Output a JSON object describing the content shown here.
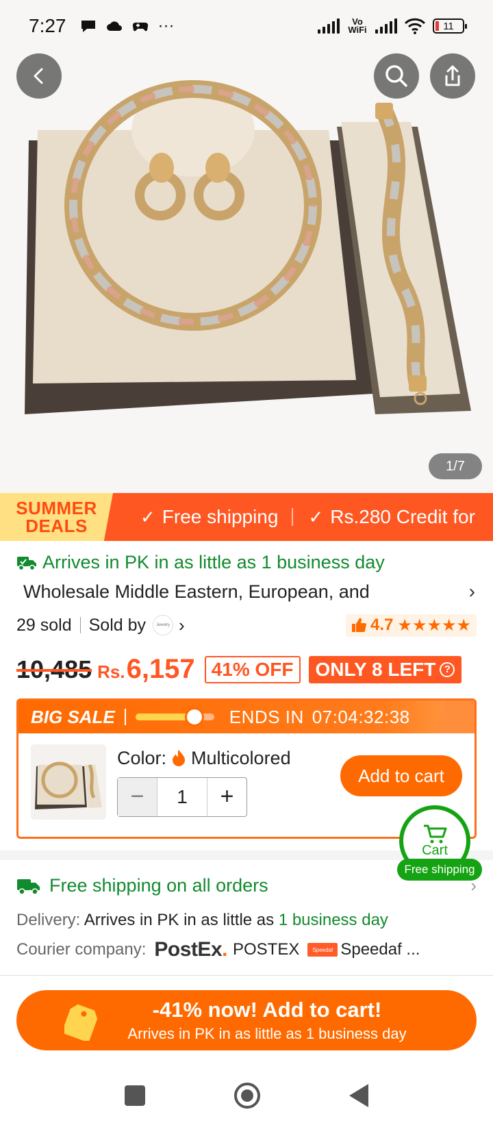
{
  "status_bar": {
    "time": "7:27",
    "more": "···",
    "network_label": "Vo WiFi",
    "battery": "11"
  },
  "gallery": {
    "page_indicator": "1/7"
  },
  "deal_banner": {
    "badge_line1": "SUMMER",
    "badge_line2": "DEALS",
    "item1": "Free shipping",
    "item2": "Rs.280 Credit for"
  },
  "product": {
    "arrival": "Arrives in PK in as little as 1 business day",
    "title": "Wholesale Middle Eastern, European, and",
    "sold": "29 sold",
    "sold_by": "Sold by",
    "store_logo_text": "Jewelry",
    "rating": "4.7",
    "stars": "★★★★★"
  },
  "price": {
    "original": "10,485",
    "currency": "Rs.",
    "current": "6,157",
    "discount": "41% OFF",
    "stock": "ONLY 8 LEFT",
    "stock_help": "?"
  },
  "big_sale": {
    "label": "BIG SALE",
    "progress": 0.75,
    "ends_label": "ENDS IN",
    "countdown": "07:04:32:38",
    "color_label": "Color:",
    "color_value": "Multicolored",
    "quantity": "1",
    "minus": "−",
    "plus": "+",
    "add_to_cart": "Add to cart"
  },
  "floating_cart": {
    "label": "Cart",
    "pill": "Free shipping"
  },
  "shipping": {
    "title": "Free shipping on all orders",
    "delivery_label": "Delivery:",
    "delivery_text": "Arrives in PK in as little as",
    "delivery_highlight": "1 business day",
    "courier_label": "Courier company:",
    "courier1_logo": "PostEx",
    "courier1_name": "POSTEX",
    "courier2_logo": "Speedaf",
    "courier2_name": "Speedaf ..."
  },
  "cta": {
    "main": "-41% now! Add to cart!",
    "sub": "Arrives in PK in as little as 1 business day"
  },
  "colors": {
    "accent": "#ff6a00",
    "deal_red": "#ff5722",
    "green": "#128a2e",
    "cart_green": "#15a313"
  }
}
